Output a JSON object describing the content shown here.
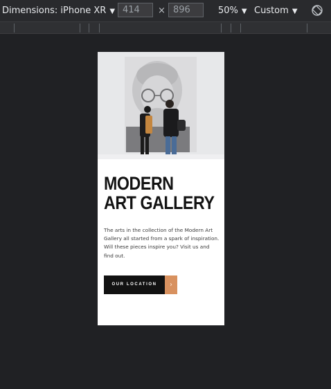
{
  "devtools": {
    "dimensions_label": "Dimensions: iPhone XR",
    "width_value": "414",
    "height_value": "896",
    "times_symbol": "×",
    "zoom_label": "50%",
    "throttle_label": "Custom",
    "caret": "▼",
    "rotate_icon": "rotate-icon"
  },
  "page": {
    "title_line1": "MODERN",
    "title_line2": "ART GALLERY",
    "description": "The arts in the collection of the Modern Art Gallery all started from a spark of inspiration. Will these pieces inspire you? Visit us and find out.",
    "cta_label": "OUR LOCATION",
    "cta_arrow": "›",
    "colors": {
      "accent": "#d8915f",
      "dark": "#121212",
      "canvas": "#202124"
    }
  }
}
